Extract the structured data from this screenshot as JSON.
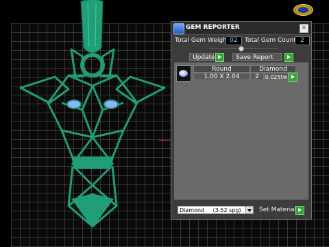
{
  "panel": {
    "title": "GEM REPORTER",
    "total_gem_weight_label": "Total Gem Weight",
    "total_gem_weight_value": "02",
    "total_gem_count_label": "Total Gem Count",
    "total_gem_count_value": "2",
    "update_label": "Update",
    "save_report_label": "Save Report",
    "table": {
      "headers": [
        "Round",
        "Diamond"
      ],
      "rows": [
        {
          "size": "1.00 X 2.04",
          "count": "2",
          "weight": "0.025tw"
        }
      ]
    },
    "material_select_value": "Diamond",
    "material_select_detail": "(3.52 spg)",
    "set_material_label": "Set Material"
  },
  "colors": {
    "model": "#1f9e78",
    "panel_bg": "#3c3c3c",
    "accent_green": "#2fa82f",
    "axis_red": "#c0202a"
  }
}
